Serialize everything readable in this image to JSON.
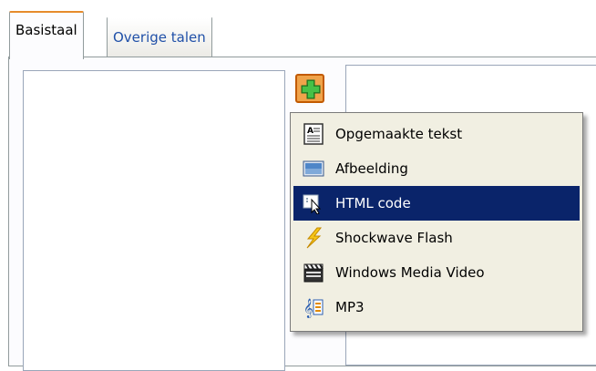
{
  "tabs": [
    {
      "label": "Basistaal",
      "active": true
    },
    {
      "label": "Overige talen",
      "active": false
    }
  ],
  "add_button": {
    "icon": "plus-icon"
  },
  "menu": {
    "items": [
      {
        "label": "Opgemaakte tekst",
        "icon": "formatted-text-icon",
        "selected": false
      },
      {
        "label": "Afbeelding",
        "icon": "image-icon",
        "selected": false
      },
      {
        "label": "HTML code",
        "icon": "html-code-icon",
        "selected": true
      },
      {
        "label": "Shockwave Flash",
        "icon": "flash-icon",
        "selected": false
      },
      {
        "label": "Windows Media Video",
        "icon": "video-clapper-icon",
        "selected": false
      },
      {
        "label": "MP3",
        "icon": "music-icon",
        "selected": false
      }
    ],
    "highlight_color": "#0a246a"
  }
}
